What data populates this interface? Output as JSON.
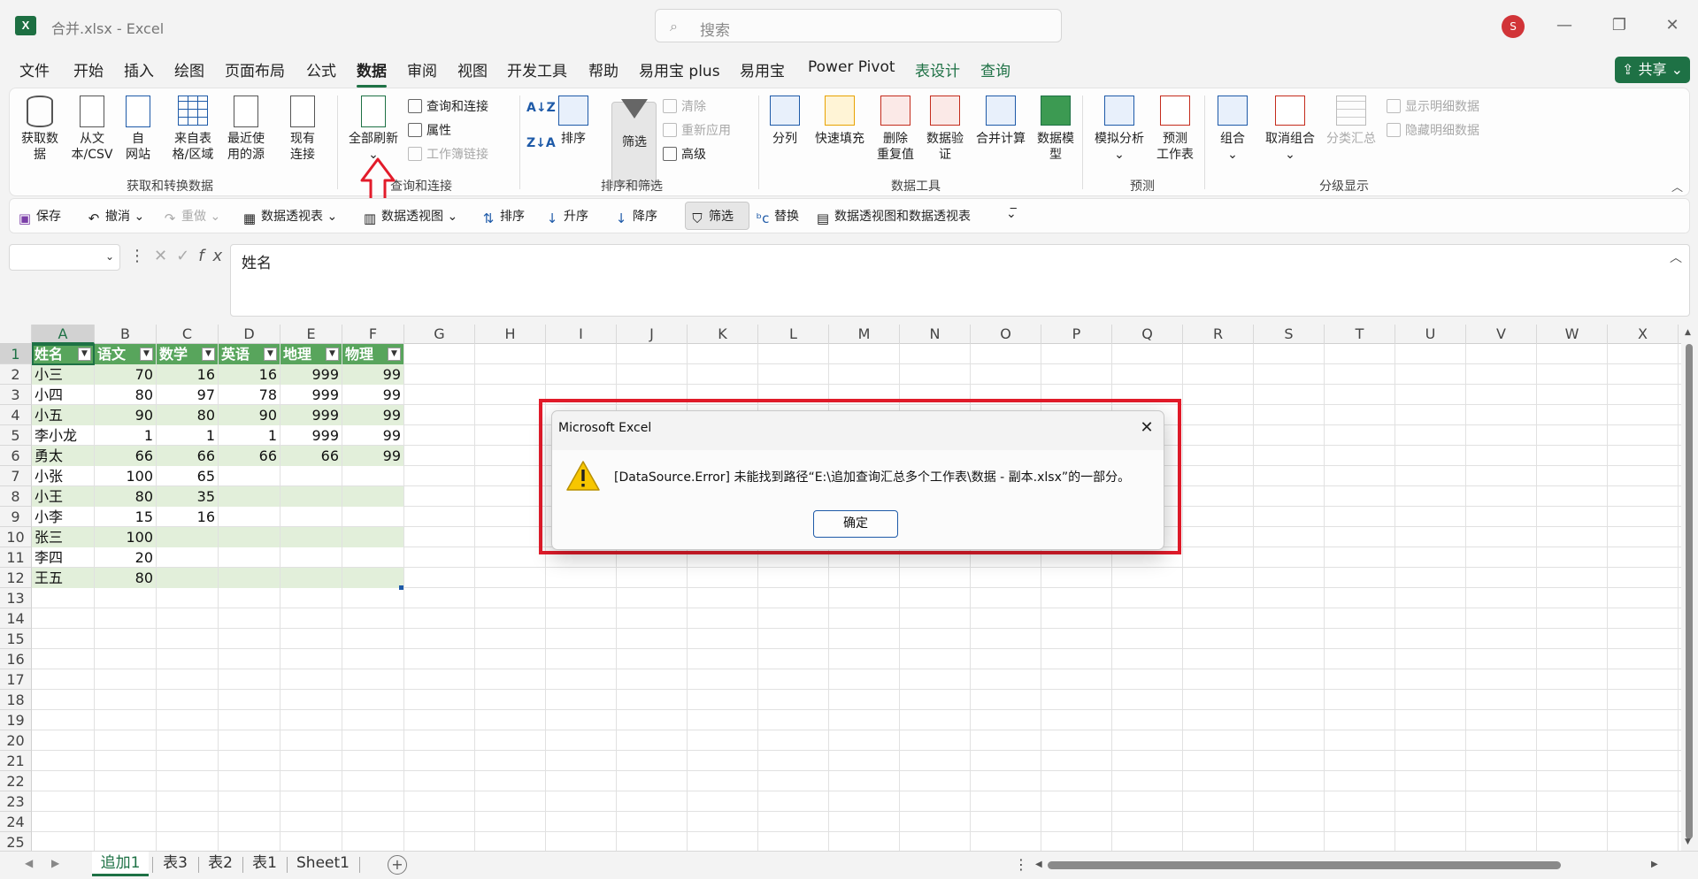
{
  "title_bar": {
    "app_icon_letter": "X",
    "document_title": "合并.xlsx  -  Excel",
    "search_placeholder": "搜索",
    "user_initial": "S"
  },
  "menu_tabs": [
    {
      "label": "文件"
    },
    {
      "label": "开始"
    },
    {
      "label": "插入"
    },
    {
      "label": "绘图"
    },
    {
      "label": "页面布局"
    },
    {
      "label": "公式"
    },
    {
      "label": "数据"
    },
    {
      "label": "审阅"
    },
    {
      "label": "视图"
    },
    {
      "label": "开发工具"
    },
    {
      "label": "帮助"
    },
    {
      "label": "易用宝 plus"
    },
    {
      "label": "易用宝"
    },
    {
      "label": "Power Pivot"
    },
    {
      "label": "表设计"
    },
    {
      "label": "查询"
    }
  ],
  "active_menu_tab": "数据",
  "share_label": "共享",
  "ribbon": {
    "get_data": "获取数\n据",
    "from_text": "从文\n本/CSV",
    "from_web": "自\n网站",
    "from_table": "来自表\n格/区域",
    "recent_sources": "最近使\n用的源",
    "existing_connections": "现有\n连接",
    "group_get_transform": "获取和转换数据",
    "refresh_all": "全部刷新",
    "queries_connections": "查询和连接",
    "properties": "属性",
    "edit_links": "工作簿链接",
    "group_queries": "查询和连接",
    "sort_label": "排序",
    "filter_label": "筛选",
    "clear": "清除",
    "reapply": "重新应用",
    "advanced": "高级",
    "group_sort_filter": "排序和筛选",
    "text_to_columns": "分列",
    "flash_fill": "快速填充",
    "remove_duplicates": "删除\n重复值",
    "data_validation": "数据验\n证",
    "consolidate": "合并计算",
    "data_model": "数据模\n型",
    "group_data_tools": "数据工具",
    "what_if": "模拟分析",
    "forecast_sheet": "预测\n工作表",
    "group_forecast": "预测",
    "group_btn": "组合",
    "ungroup": "取消组合",
    "subtotal": "分类汇总",
    "show_detail": "显示明细数据",
    "hide_detail": "隐藏明细数据",
    "group_outline": "分级显示"
  },
  "qat": {
    "save": "保存",
    "undo": "撤消",
    "redo": "重做",
    "pivot_table": "数据透视表",
    "pivot_chart": "数据透视图",
    "sort": "排序",
    "ascending": "升序",
    "descending": "降序",
    "filter": "筛选",
    "replace": "替换",
    "pivot_chart_table": "数据透视图和数据透视表"
  },
  "formula_bar": {
    "name_box": "",
    "formula": "姓名"
  },
  "columns": [
    "A",
    "B",
    "C",
    "D",
    "E",
    "F",
    "G",
    "H",
    "I",
    "J",
    "K",
    "L",
    "M",
    "N",
    "O",
    "P",
    "Q",
    "R",
    "S",
    "T",
    "U",
    "V",
    "W",
    "X"
  ],
  "rows": [
    "1",
    "2",
    "3",
    "4",
    "5",
    "6",
    "7",
    "8",
    "9",
    "10",
    "11",
    "12",
    "13",
    "14",
    "15",
    "16",
    "17",
    "18",
    "19",
    "20",
    "21",
    "22",
    "23",
    "24",
    "25"
  ],
  "table": {
    "headers": [
      "姓名",
      "语文",
      "数学",
      "英语",
      "地理",
      "物理"
    ],
    "data": [
      [
        "小三",
        "70",
        "16",
        "16",
        "999",
        "99"
      ],
      [
        "小四",
        "80",
        "97",
        "78",
        "999",
        "99"
      ],
      [
        "小五",
        "90",
        "80",
        "90",
        "999",
        "99"
      ],
      [
        "李小龙",
        "1",
        "1",
        "1",
        "999",
        "99"
      ],
      [
        "勇太",
        "66",
        "66",
        "66",
        "66",
        "99"
      ],
      [
        "小张",
        "100",
        "65",
        "",
        "",
        ""
      ],
      [
        "小王",
        "80",
        "35",
        "",
        "",
        ""
      ],
      [
        "小李",
        "15",
        "16",
        "",
        "",
        ""
      ],
      [
        "张三",
        "100",
        "",
        "",
        "",
        ""
      ],
      [
        "李四",
        "20",
        "",
        "",
        "",
        ""
      ],
      [
        "王五",
        "80",
        "",
        "",
        "",
        ""
      ]
    ]
  },
  "sheet_tabs": [
    {
      "label": "追加1"
    },
    {
      "label": "表3"
    },
    {
      "label": "表2"
    },
    {
      "label": "表1"
    },
    {
      "label": "Sheet1"
    }
  ],
  "active_sheet": "追加1",
  "dialog": {
    "title": "Microsoft Excel",
    "message": "[DataSource.Error] 未能找到路径“E:\\追加查询汇总多个工作表\\数据 - 副本.xlsx”的一部分。",
    "ok_label": "确定"
  },
  "colors": {
    "excel_green": "#1e7145",
    "table_header": "#58a55c",
    "table_band": "#e2efda",
    "highlight_red": "#e21b2a"
  }
}
